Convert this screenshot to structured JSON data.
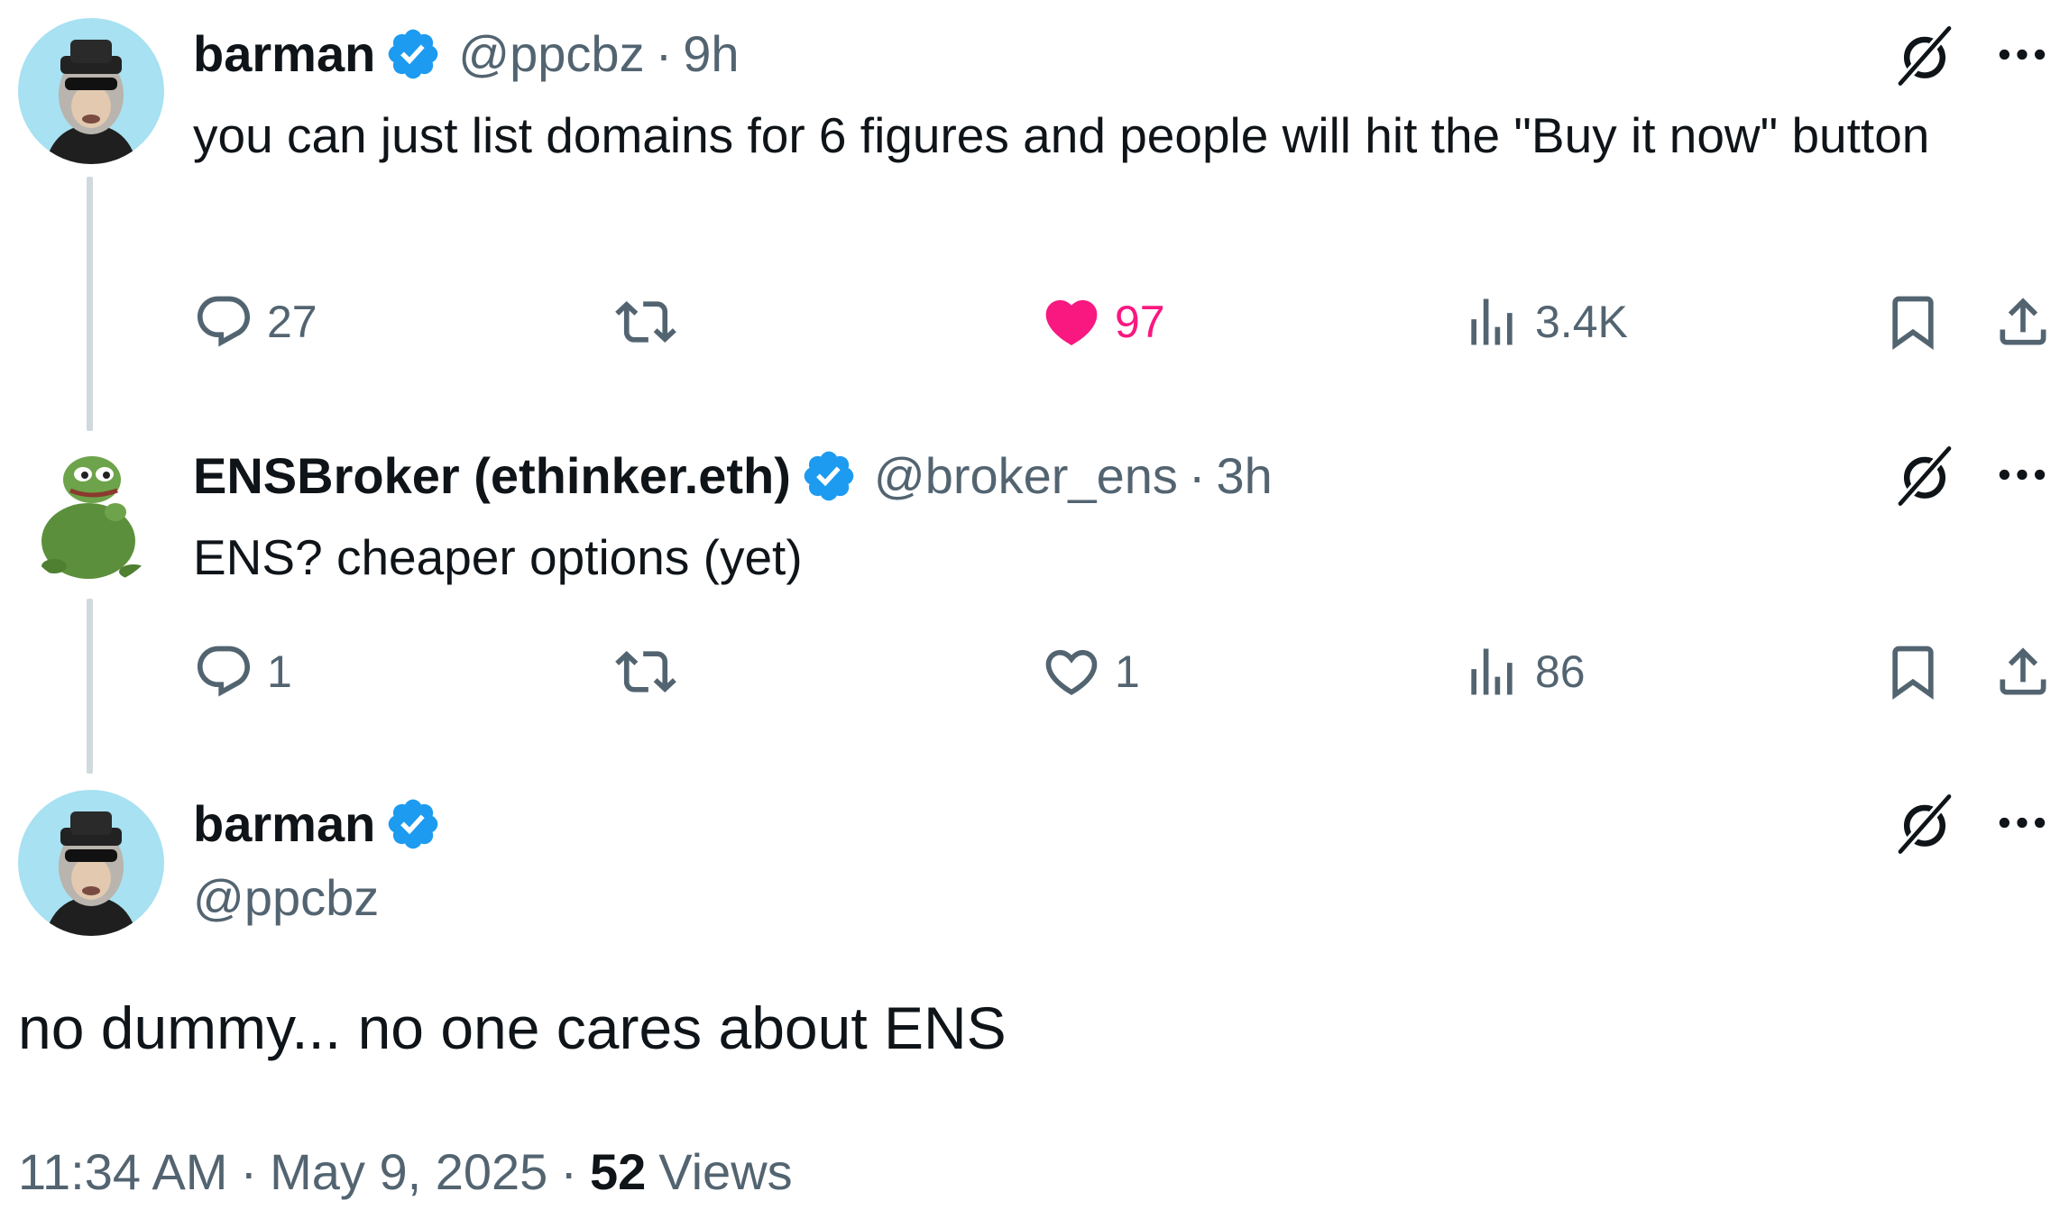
{
  "tweets": [
    {
      "name": "barman",
      "handle": "@ppcbz",
      "sep": "·",
      "time": "9h",
      "text": "you can just list domains for 6 figures and people will hit the \"Buy it now\" button",
      "replies": "27",
      "reposts": "",
      "likes": "97",
      "views": "3.4K",
      "liked": true
    },
    {
      "name": "ENSBroker (ethinker.eth)",
      "handle": "@broker_ens",
      "sep": "·",
      "time": "3h",
      "text": "ENS? cheaper options (yet)",
      "replies": "1",
      "reposts": "",
      "likes": "1",
      "views": "86",
      "liked": false
    }
  ],
  "main": {
    "name": "barman",
    "handle": "@ppcbz",
    "text": "no dummy... no one cares about ENS",
    "time": "11:34 AM",
    "sep1": "·",
    "date": "May 9, 2025",
    "sep2": "·",
    "views_count": "52",
    "views_label": "Views"
  },
  "colors": {
    "verified": "#1d9bf0",
    "like": "#f91880",
    "secondary": "#536471"
  },
  "icons": [
    "verified-badge-icon",
    "grok-icon",
    "more-icon",
    "reply-icon",
    "repost-icon",
    "heart-icon",
    "views-icon",
    "bookmark-icon",
    "share-icon"
  ]
}
